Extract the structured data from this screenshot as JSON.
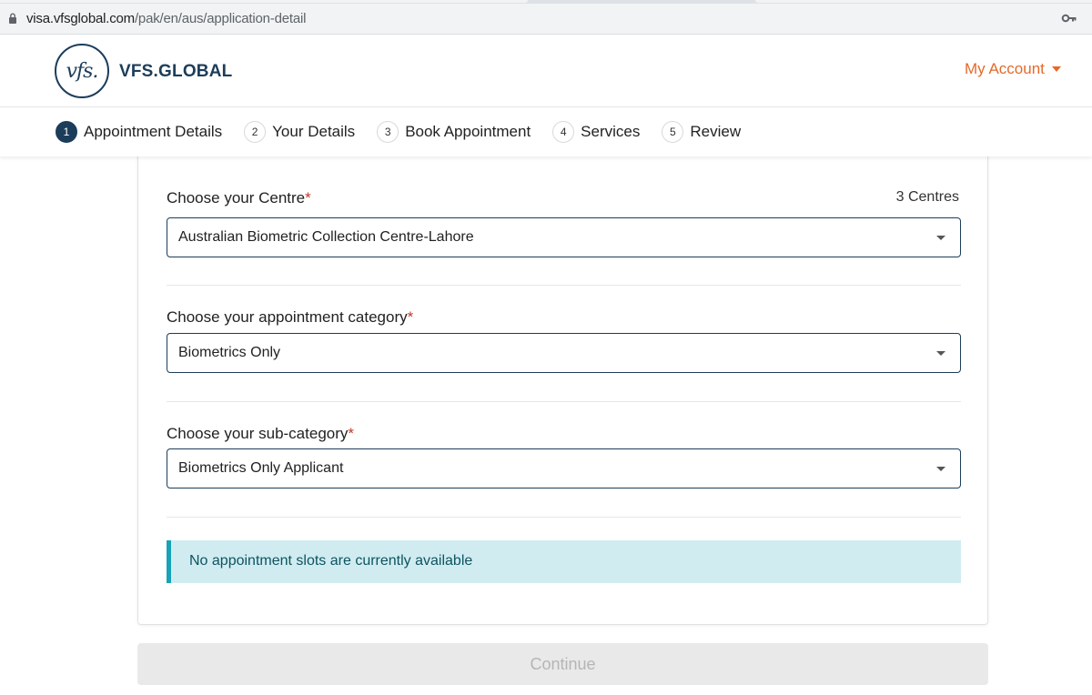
{
  "browser": {
    "url_host": "visa.vfsglobal.com",
    "url_path": "/pak/en/aus/application-detail"
  },
  "header": {
    "logo_mark": "vfs.",
    "brand": "VFS.GLOBAL",
    "my_account": "My Account"
  },
  "stepper": {
    "steps": [
      {
        "num": "1",
        "label": "Appointment Details",
        "active": true
      },
      {
        "num": "2",
        "label": "Your Details",
        "active": false
      },
      {
        "num": "3",
        "label": "Book Appointment",
        "active": false
      },
      {
        "num": "4",
        "label": "Services",
        "active": false
      },
      {
        "num": "5",
        "label": "Review",
        "active": false
      }
    ]
  },
  "form": {
    "centre": {
      "label": "Choose your Centre",
      "required_mark": "*",
      "count": "3 Centres",
      "value": "Australian Biometric Collection Centre-Lahore"
    },
    "category": {
      "label": "Choose your appointment category",
      "required_mark": "*",
      "value": "Biometrics Only"
    },
    "subcategory": {
      "label": "Choose your sub-category",
      "required_mark": "*",
      "value": "Biometrics Only Applicant"
    },
    "alert": "No appointment slots are currently available"
  },
  "continue_label": "Continue",
  "colors": {
    "brand_navy": "#1c3d5a",
    "accent_orange": "#e36a2b",
    "alert_bg": "#d1ecf1",
    "alert_border": "#17a2b8"
  }
}
